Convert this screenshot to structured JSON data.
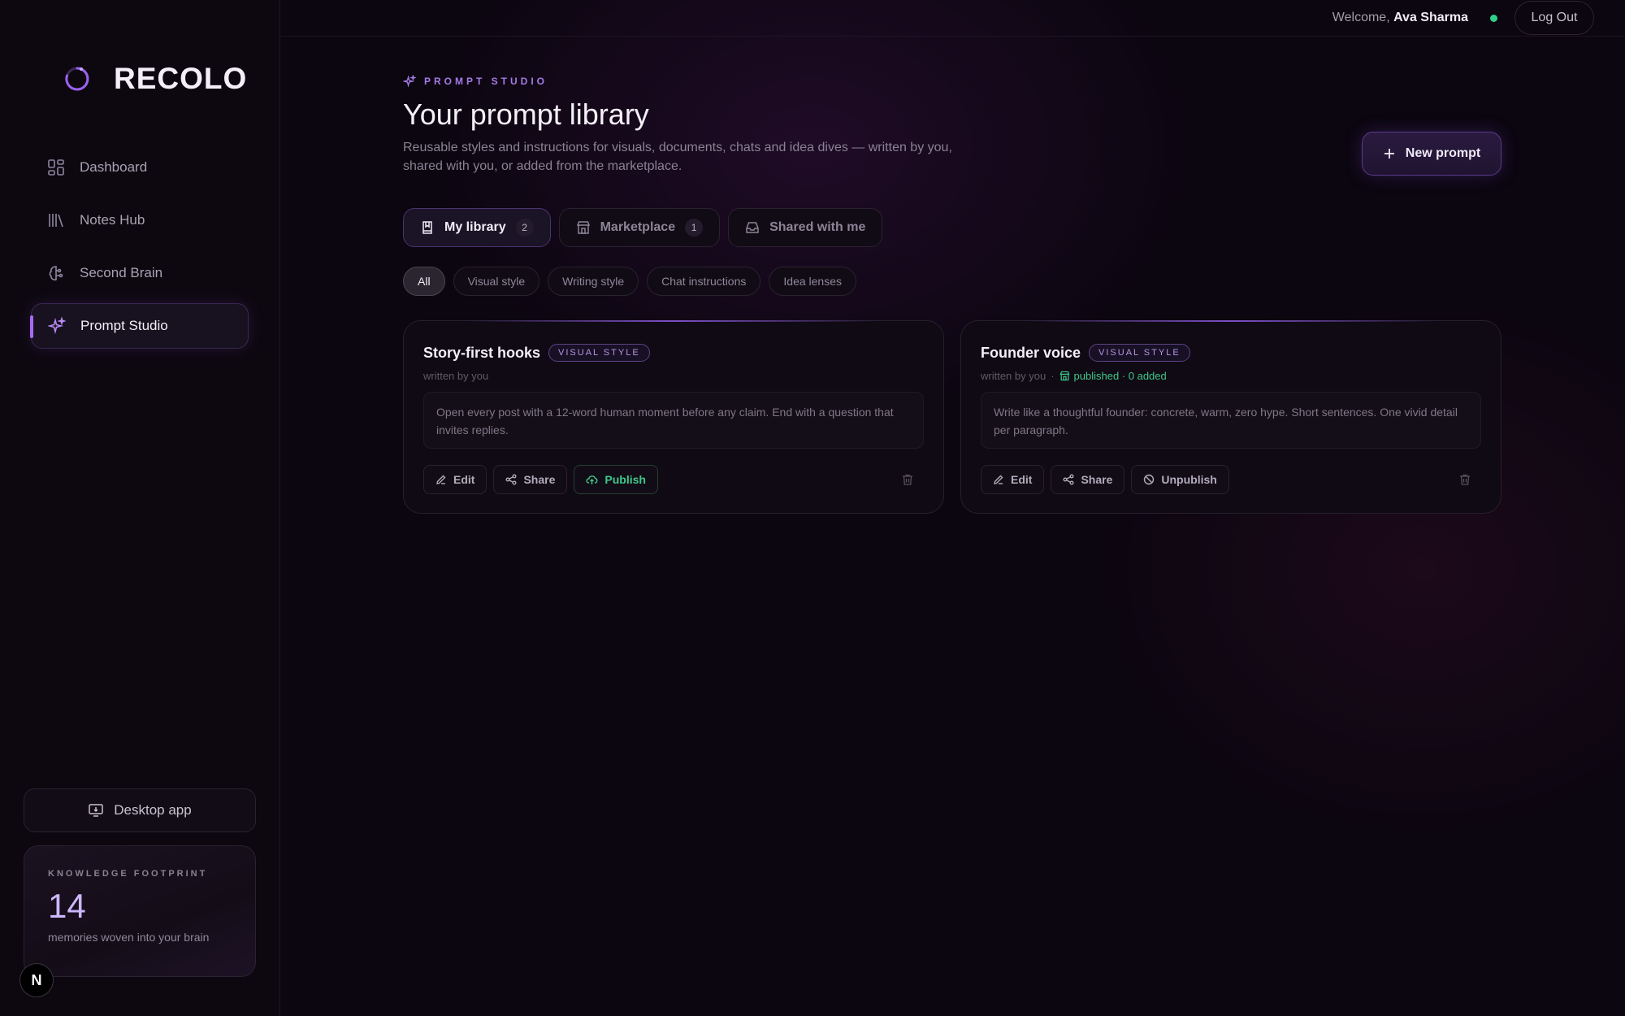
{
  "app": {
    "name": "RECOLO"
  },
  "sidebar": {
    "items": [
      {
        "label": "Dashboard",
        "icon": "dashboard-icon"
      },
      {
        "label": "Notes Hub",
        "icon": "library-icon"
      },
      {
        "label": "Second Brain",
        "icon": "brain-icon"
      },
      {
        "label": "Prompt Studio",
        "icon": "sparkles-icon",
        "active": true
      }
    ],
    "desktop_app_label": "Desktop app",
    "footprint": {
      "label": "KNOWLEDGE FOOTPRINT",
      "count": "14",
      "caption": "memories woven into your brain"
    },
    "badge_letter": "N"
  },
  "topbar": {
    "welcome_prefix": "Welcome,",
    "user_name": "Ava Sharma",
    "logout_label": "Log Out",
    "status_color": "#2fd18a"
  },
  "header": {
    "eyebrow": "PROMPT STUDIO",
    "title": "Your prompt library",
    "subtitle": "Reusable styles and instructions for visuals, documents, chats and idea dives — written by you, shared with you, or added from the marketplace.",
    "new_prompt_label": "New prompt"
  },
  "tabs": [
    {
      "label": "My library",
      "count": "2",
      "active": true
    },
    {
      "label": "Marketplace",
      "count": "1"
    },
    {
      "label": "Shared with me"
    }
  ],
  "filters": [
    "All",
    "Visual style",
    "Writing style",
    "Chat instructions",
    "Idea lenses"
  ],
  "cards": [
    {
      "title": "Story-first hooks",
      "tag": "VISUAL STYLE",
      "author": "written by you",
      "body": "Open every post with a 12-word human moment before any claim. End with a question that invites replies.",
      "actions": {
        "edit": "Edit",
        "share": "Share",
        "toggle": "Publish"
      }
    },
    {
      "title": "Founder voice",
      "tag": "VISUAL STYLE",
      "author": "written by you",
      "published": "published · 0 added",
      "body": "Write like a thoughtful founder: concrete, warm, zero hype. Short sentences. One vivid detail per paragraph.",
      "actions": {
        "edit": "Edit",
        "share": "Share",
        "toggle": "Unpublish"
      }
    }
  ],
  "colors": {
    "accent": "#a46cf0",
    "published": "#3fc98c",
    "background": "#0b0610"
  }
}
